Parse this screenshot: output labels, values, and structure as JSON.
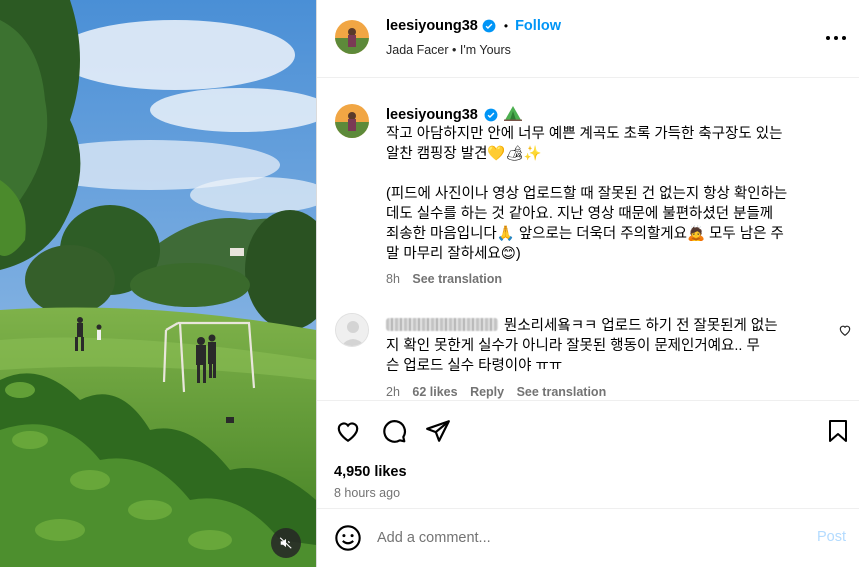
{
  "post": {
    "username": "leesiyoung38",
    "follow_label": "Follow",
    "separator": "•",
    "audio_artist": "Jada Facer",
    "audio_sep": "•",
    "audio_title": "I'm Yours"
  },
  "caption": {
    "username": "leesiyoung38",
    "lines": [
      "작고 아담하지만 안에 너무 예쁜 계곡도 초록 가득한 축구장도 있는",
      "알찬 캠핑장 발견💛🏕✨",
      "(피드에 사진이나 영상 업로드할 때 잘못된 건 없는지 항상 확인하는",
      "데도 실수를 하는 것 같아요. 지난 영상 때문에 불편하셨던 분들께",
      "죄송한 마음입니다🙏 앞으로는 더욱더 주의할게요🙇 모두 남은 주",
      "말 마무리 잘하세요😊)"
    ],
    "time": "8h",
    "see_translation": "See translation"
  },
  "comment": {
    "lines": [
      "뭔소리세욬ㅋㅋ 업로드 하기 전 잘못된게 없는",
      "지 확인 못한게 실수가 아니라 잘못된 행동이 문제인거예요.. 무",
      "슨 업로드 실수 타령이야 ㅠㅠ"
    ],
    "time": "2h",
    "likes": "62 likes",
    "reply": "Reply",
    "see_translation": "See translation"
  },
  "actions": {
    "like_icon": "heart-icon",
    "comment_icon": "comment-icon",
    "share_icon": "share-icon",
    "save_icon": "bookmark-icon"
  },
  "stats": {
    "likes": "4,950 likes",
    "posted": "8 hours ago"
  },
  "add_comment": {
    "placeholder": "Add a comment...",
    "post_label": "Post"
  },
  "media": {
    "mute_icon": "speaker-muted-icon"
  },
  "colors": {
    "accent": "#0095f6",
    "verified": "#0095f6",
    "muted_text": "#737373",
    "post_disabled": "#b3dbff"
  }
}
